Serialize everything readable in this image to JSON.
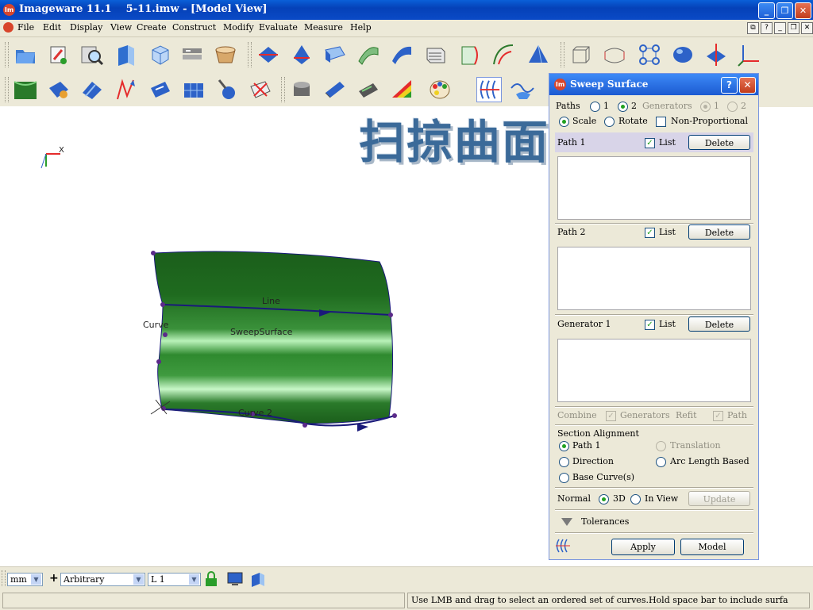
{
  "window": {
    "title": "Imageware 11.1    5-11.imw - [Model View]",
    "icon_label": "Im",
    "controls": [
      "_",
      "❐",
      "✕"
    ]
  },
  "menu": {
    "items": [
      "File",
      "Edit",
      "Display",
      "View",
      "Create",
      "Construct",
      "Modify",
      "Evaluate",
      "Measure",
      "Help"
    ],
    "mdi_controls": [
      "⧉",
      "?",
      "_",
      "❐",
      "✕"
    ]
  },
  "watermark": "扫掠曲面",
  "viewport": {
    "labels": {
      "line": "Line",
      "curve": "Curve",
      "surface": "SweepSurface",
      "curve2": "Curve 2"
    },
    "axis_label": "X",
    "surface_color": "#1f6b1f",
    "curve_color": "#1a1a7a"
  },
  "sweep_panel": {
    "icon_label": "Im",
    "title": "Sweep Surface",
    "help_button": "?",
    "close_button": "✕",
    "paths_label": "Paths",
    "paths_option_1": "1",
    "paths_option_2": "2",
    "generators_label": "Generators",
    "generators_option_1": "1",
    "generators_option_2": "2",
    "mode_scale": "Scale",
    "mode_rotate": "Rotate",
    "mode_nonprop": "Non-Proportional",
    "path1_label": "Path 1",
    "path2_label": "Path 2",
    "generator1_label": "Generator 1",
    "list_label": "List",
    "delete_label": "Delete",
    "combine_label": "Combine",
    "combine_generators": "Generators",
    "refit_label": "Refit",
    "refit_path": "Path",
    "section_alignment_label": "Section Alignment",
    "align_path1": "Path 1",
    "align_translation": "Translation",
    "align_direction": "Direction",
    "align_arclength": "Arc Length Based",
    "align_basecurves": "Base Curve(s)",
    "normal_label": "Normal",
    "normal_3d": "3D",
    "normal_inview": "In View",
    "update_label": "Update",
    "tolerances_label": "Tolerances",
    "apply_label": "Apply",
    "model_label": "Model"
  },
  "bottom": {
    "units": "mm",
    "plus": "+",
    "orientation": "Arbitrary",
    "layer": "L 1",
    "status_left": "",
    "status_message": "Use LMB and drag to select an ordered set of curves.Hold space bar to include surfa"
  },
  "colors": {
    "title_blue": "#0a4ac6",
    "chrome": "#ece9d8",
    "check_green": "#21a121"
  }
}
